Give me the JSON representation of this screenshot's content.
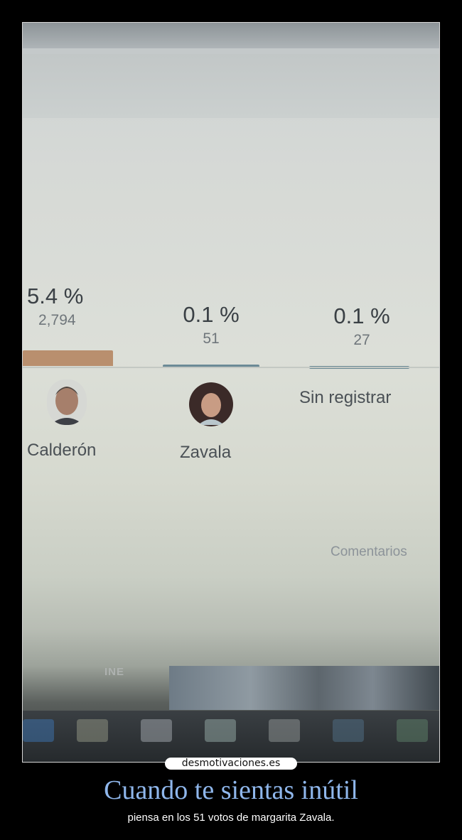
{
  "results": {
    "candidates": [
      {
        "percent": "5.4 %",
        "votes": "2,794",
        "name": "Calderón",
        "share": 0.054
      },
      {
        "percent": "0.1 %",
        "votes": "51",
        "name": "Zavala",
        "share": 0.001
      },
      {
        "percent": "0.1 %",
        "votes": "27",
        "name": "Sin registrar",
        "share": 0.001
      }
    ],
    "comments_link": "Comentarios",
    "footer_logo": "INE"
  },
  "colors": {
    "bar_calderon": "#b98f6e",
    "bar_small": "#6b8a96",
    "caption_title": "#8fb7ec"
  },
  "watermark": "desmotivaciones.es",
  "caption": {
    "title": "Cuando te sientas inútil",
    "subtitle": "piensa en los 51 votos de margarita Zavala."
  }
}
